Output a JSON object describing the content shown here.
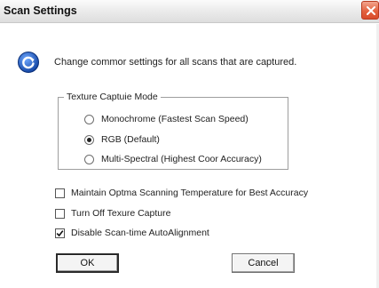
{
  "window": {
    "title": "Scan Settings",
    "close_icon": "close-icon"
  },
  "info": {
    "icon": "refresh-icon",
    "text": "Change commor settings for all scans that are captured."
  },
  "texture_group": {
    "legend": "Texture Captuie Mode",
    "options": [
      {
        "label": "Monochrome (Fastest Scan Speed)",
        "selected": false
      },
      {
        "label": "RGB (Default)",
        "selected": true
      },
      {
        "label": "Multi-Spectral (Highest Coor Accuracy)",
        "selected": false
      }
    ]
  },
  "checkboxes": [
    {
      "label": "Maintain Optma Scanning Temperature for Best Accuracy",
      "checked": false
    },
    {
      "label": "Turn Off Texure Capture",
      "checked": false
    },
    {
      "label": "Disable Scan-time AutoAlignment",
      "checked": true
    }
  ],
  "buttons": {
    "ok_label": "OK",
    "cancel_label": "Cancel"
  },
  "colors": {
    "close_button": "#e4623f",
    "info_icon": "#1c5fd0"
  }
}
